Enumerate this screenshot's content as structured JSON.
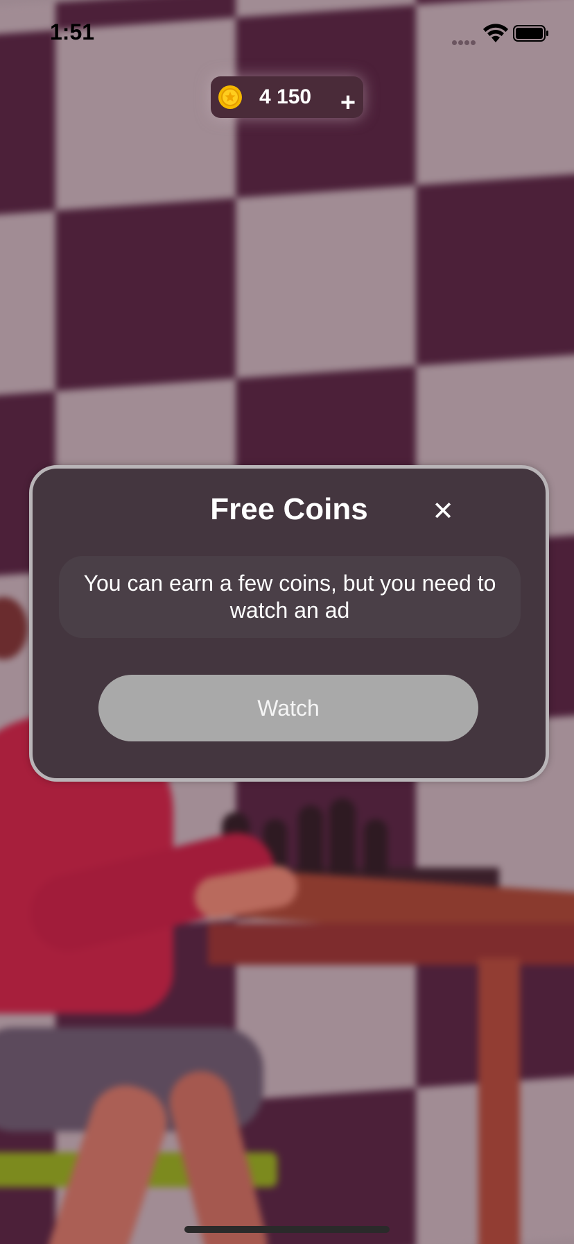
{
  "status_bar": {
    "time": "1:51"
  },
  "coins": {
    "amount": "4 150",
    "coin_icon": "gold-coin-icon",
    "add_icon": "plus-icon",
    "add_label": "+"
  },
  "modal": {
    "title": "Free Coins",
    "close_label": "✕",
    "message": "You can earn a few coins, but you need to watch an ad",
    "watch_label": "Watch"
  },
  "colors": {
    "modal_background": "#44363f",
    "modal_border": "#b9b5b8",
    "watch_button": "#a9a9a9",
    "coin_pill": "#4a2b39",
    "coin_gold": "#f5b800"
  }
}
